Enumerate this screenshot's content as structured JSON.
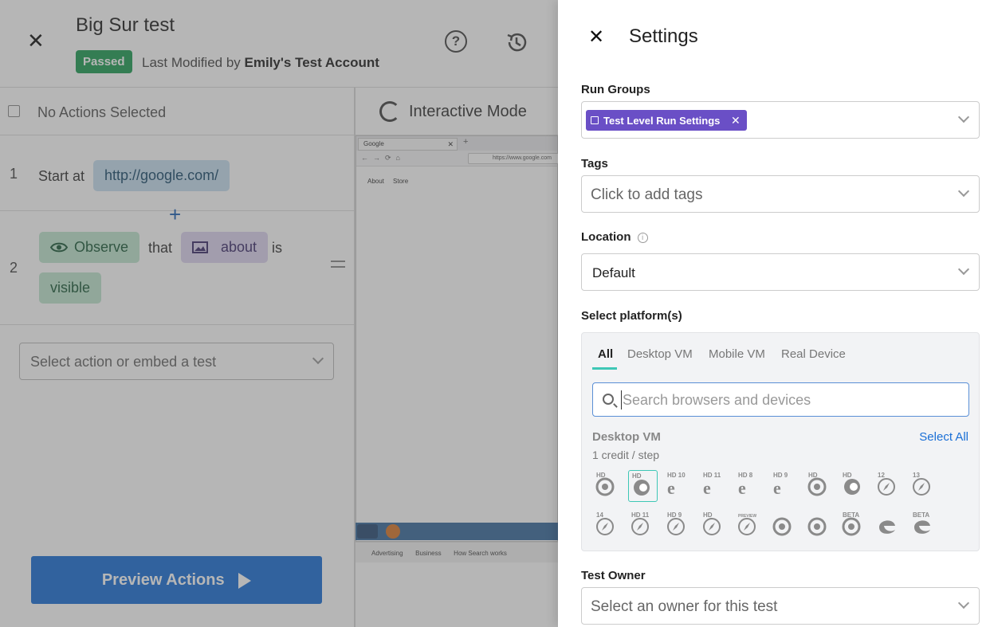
{
  "test": {
    "title": "Big Sur test",
    "status": "Passed",
    "modified_prefix": "Last Modified by",
    "modified_by": "Emily's Test Account"
  },
  "steps_panel": {
    "selection_label": "No Actions Selected",
    "steps": [
      {
        "number": "1",
        "prefix": "Start at",
        "url": "http://google.com/"
      },
      {
        "number": "2",
        "action": "Observe",
        "that": "that",
        "target": "about",
        "is": "is",
        "state": "visible"
      }
    ],
    "add_step_symbol": "+",
    "select_action_placeholder": "Select action or embed a test",
    "preview_button": "Preview Actions"
  },
  "interactive": {
    "label": "Interactive Mode",
    "tab_title": "Google",
    "url": "https://www.google.com",
    "page_links": [
      "About",
      "Store"
    ],
    "footer_links": [
      "Advertising",
      "Business",
      "How Search works"
    ]
  },
  "settings": {
    "title": "Settings",
    "run_groups": {
      "label": "Run Groups",
      "chip": "Test Level Run Settings"
    },
    "tags": {
      "label": "Tags",
      "placeholder": "Click to add tags"
    },
    "location": {
      "label": "Location",
      "value": "Default"
    },
    "platforms": {
      "label": "Select platform(s)",
      "tabs": [
        "All",
        "Desktop VM",
        "Mobile VM",
        "Real Device"
      ],
      "active_tab": "All",
      "search_placeholder": "Search browsers and devices",
      "group_title": "Desktop VM",
      "group_credit": "1 credit / step",
      "select_all": "Select All",
      "browsers_row1": [
        {
          "name": "chrome-hd-icon",
          "badge": "HD"
        },
        {
          "name": "firefox-hd-icon",
          "badge": "HD",
          "selected": true
        },
        {
          "name": "ie10-hd-icon",
          "badge": "HD 10"
        },
        {
          "name": "ie11-hd-icon",
          "badge": "HD 11"
        },
        {
          "name": "ie8-hd-icon",
          "badge": "HD 8"
        },
        {
          "name": "ie9-hd-icon",
          "badge": "HD 9"
        },
        {
          "name": "chrome-mac-hd-icon",
          "badge": "HD"
        },
        {
          "name": "firefox-mac-hd-icon",
          "badge": "HD"
        },
        {
          "name": "safari12-icon",
          "badge": "12"
        },
        {
          "name": "safari13-icon",
          "badge": "13"
        }
      ],
      "browsers_row2": [
        {
          "name": "safari14-icon",
          "badge": "14"
        },
        {
          "name": "safari11-hd-icon",
          "badge": "HD 11"
        },
        {
          "name": "safari9-hd-icon",
          "badge": "HD 9"
        },
        {
          "name": "safari-hd-icon",
          "badge": "HD"
        },
        {
          "name": "safari-preview-icon",
          "badge": "PREVIEW"
        },
        {
          "name": "chrome-linux-icon",
          "badge": ""
        },
        {
          "name": "chrome-windows-icon",
          "badge": ""
        },
        {
          "name": "chrome-beta-icon",
          "badge": "BETA"
        },
        {
          "name": "edge-icon",
          "badge": ""
        },
        {
          "name": "edge-beta-icon",
          "badge": "BETA"
        }
      ]
    },
    "owner": {
      "label": "Test Owner",
      "placeholder": "Select an owner for this test"
    }
  },
  "colors": {
    "accent_blue": "#1a6fd6",
    "passed_green": "#1f9d55",
    "chip_purple": "#6a4fc6",
    "tab_underline": "#3ec7b6"
  }
}
